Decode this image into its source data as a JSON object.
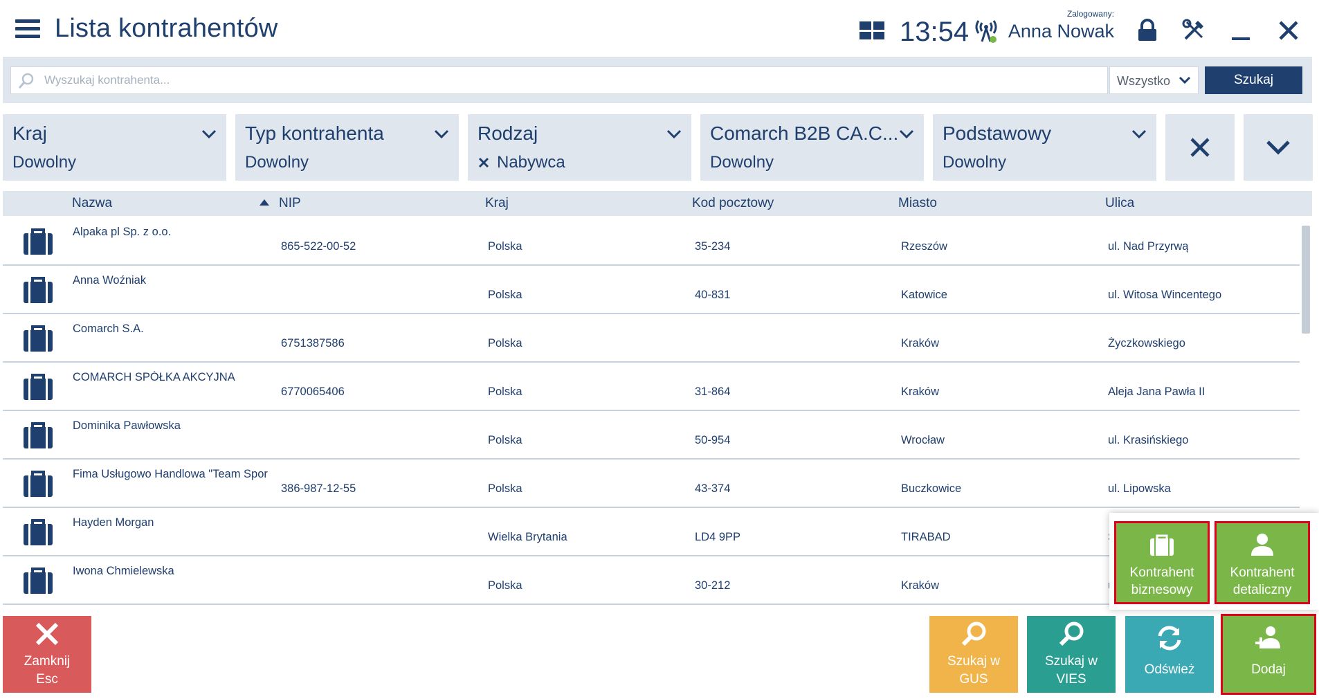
{
  "header": {
    "title": "Lista kontrahentów",
    "clock": "13:54",
    "login_caption": "Zalogowany:",
    "user_name": "Anna Nowak"
  },
  "search": {
    "placeholder": "Wyszukaj kontrahenta...",
    "value": "",
    "scope": "Wszystko",
    "button": "Szukaj"
  },
  "filters": [
    {
      "title": "Kraj",
      "value": "Dowolny",
      "cleared": false
    },
    {
      "title": "Typ kontrahenta",
      "value": "Dowolny",
      "cleared": false
    },
    {
      "title": "Rodzaj",
      "value": "Nabywca",
      "cleared": true
    },
    {
      "title": "Comarch B2B CA.C...",
      "value": "Dowolny",
      "cleared": false
    },
    {
      "title": "Podstawowy",
      "value": "Dowolny",
      "cleared": false
    }
  ],
  "table": {
    "columns": [
      "Nazwa",
      "NIP",
      "Kraj",
      "Kod pocztowy",
      "Miasto",
      "Ulica"
    ],
    "sort_column": "Nazwa",
    "sort_direction": "asc",
    "rows": [
      {
        "name": "Alpaka pl Sp. z o.o.",
        "nip": "865-522-00-52",
        "kraj": "Polska",
        "kod": "35-234",
        "miasto": "Rzeszów",
        "ulica": "ul. Nad Przyrwą"
      },
      {
        "name": "Anna Woźniak",
        "nip": "",
        "kraj": "Polska",
        "kod": "40-831",
        "miasto": "Katowice",
        "ulica": "ul. Witosa Wincentego"
      },
      {
        "name": "Comarch S.A.",
        "nip": "6751387586",
        "kraj": "Polska",
        "kod": "",
        "miasto": "Kraków",
        "ulica": "Życzkowskiego"
      },
      {
        "name": "COMARCH SPÓŁKA AKCYJNA",
        "nip": "6770065406",
        "kraj": "Polska",
        "kod": "31-864",
        "miasto": "Kraków",
        "ulica": "Aleja Jana Pawła II"
      },
      {
        "name": "Dominika Pawłowska",
        "nip": "",
        "kraj": "Polska",
        "kod": "50-954",
        "miasto": "Wrocław",
        "ulica": "ul. Krasińskiego"
      },
      {
        "name": "Fima Usługowo Handlowa \"Team Spor",
        "nip": "386-987-12-55",
        "kraj": "Polska",
        "kod": "43-374",
        "miasto": "Buczkowice",
        "ulica": "ul. Lipowska"
      },
      {
        "name": "Hayden Morgan",
        "nip": "",
        "kraj": "Wielka Brytania",
        "kod": "LD4 9PP",
        "miasto": "TIRABAD",
        "ulica": "S"
      },
      {
        "name": "Iwona Chmielewska",
        "nip": "",
        "kraj": "Polska",
        "kod": "30-212",
        "miasto": "Kraków",
        "ulica": "u"
      }
    ]
  },
  "add_popup": {
    "business_line1": "Kontrahent",
    "business_line2": "biznesowy",
    "retail_line1": "Kontrahent",
    "retail_line2": "detaliczny"
  },
  "buttons": {
    "close_line1": "Zamknij",
    "close_line2": "Esc",
    "gus_line1": "Szukaj w",
    "gus_line2": "GUS",
    "vies_line1": "Szukaj w",
    "vies_line2": "VIES",
    "refresh": "Odśwież",
    "add": "Dodaj"
  },
  "colors": {
    "primary": "#1f3f6e",
    "panel": "#dfe6ee",
    "close": "#d95a5a",
    "gus": "#f0b44a",
    "vies": "#2a9e91",
    "refresh": "#3aa9b4",
    "add": "#7ab648",
    "highlight": "#e0001a"
  },
  "icons": {
    "menu": "hamburger-icon",
    "tiles": "tiles-icon",
    "connection": "signal-icon",
    "lock": "lock-icon",
    "tools": "tools-icon",
    "minimize": "minimize-icon",
    "close": "close-icon",
    "row": "briefcase-icon"
  }
}
